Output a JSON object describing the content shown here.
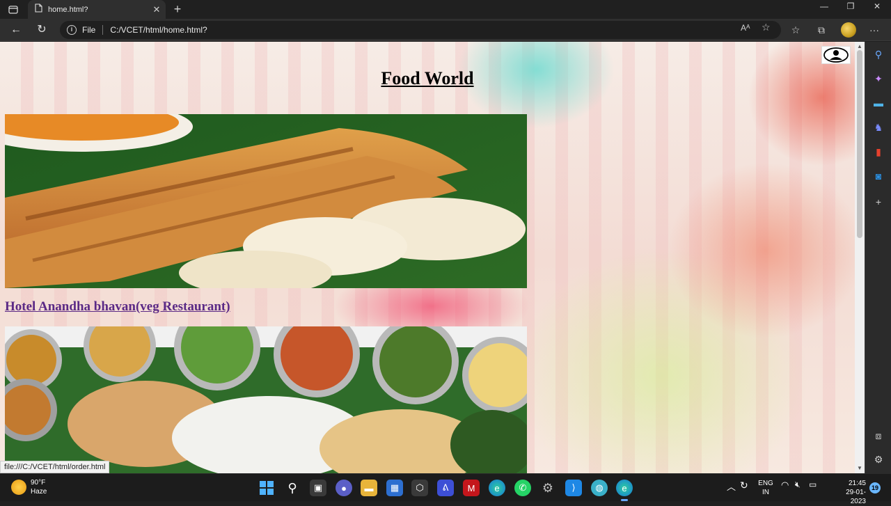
{
  "browser": {
    "tab_title": "home.html?",
    "address_scheme": "File",
    "address_url": "C:/VCET/html/home.html?",
    "icons": [
      "tab-actions-icon",
      "page-icon",
      "close-icon",
      "plus-icon",
      "back-icon",
      "refresh-icon",
      "info-icon",
      "read-aloud-icon",
      "favorite-add-icon",
      "favorites-icon",
      "collections-icon",
      "profile-icon",
      "more-icon"
    ]
  },
  "page": {
    "title": "Food World",
    "restaurant_link": "Hotel Anandha bhavan(veg Restaurant)",
    "status_url": "file:///C:/VCET/html/order.html"
  },
  "sidebar": {
    "icons": [
      "search-icon",
      "copilot-icon",
      "tools-icon",
      "games-icon",
      "office-icon",
      "outlook-icon",
      "add-icon",
      "split-screen-icon",
      "settings-icon"
    ]
  },
  "taskbar": {
    "weather_temp": "90°F",
    "weather_desc": "Haze",
    "lang_top": "ENG",
    "lang_bottom": "IN",
    "time": "21:45",
    "date": "29-01-2023",
    "notifications": "19"
  }
}
